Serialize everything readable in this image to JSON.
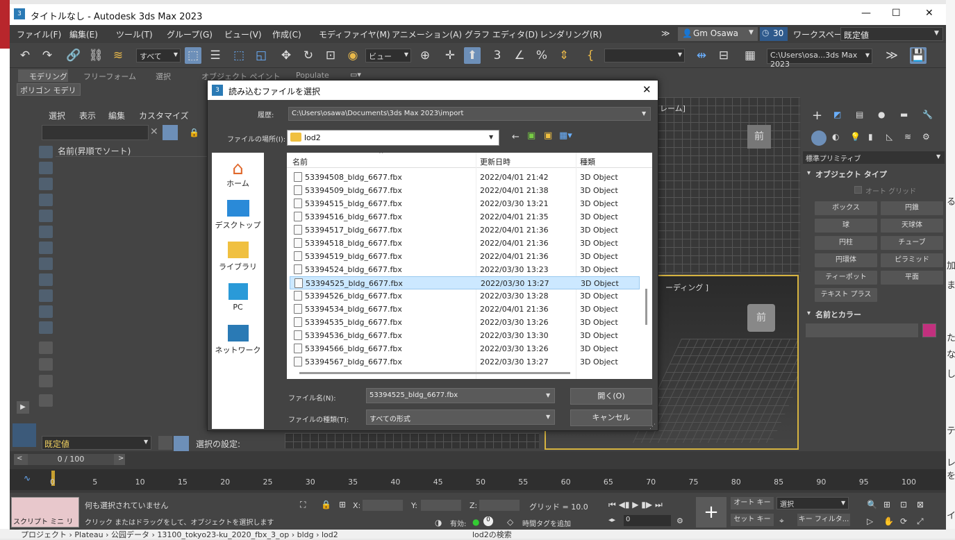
{
  "window": {
    "title": "タイトルなし - Autodesk 3ds Max 2023",
    "minimize": "—",
    "maximize": "☐",
    "close": "✕"
  },
  "menu": {
    "items": [
      "ファイル(F)",
      "編集(E)",
      "ツール(T)",
      "グループ(G)",
      "ビュー(V)",
      "作成(C)",
      "モディファイヤ(M)",
      "アニメーション(A)",
      "グラフ エディタ(D)",
      "レンダリング(R)"
    ],
    "more": "≫",
    "user": "Gm Osawa",
    "clock": "30",
    "workspace_label": "ワークスペース:",
    "workspace_value": "既定値"
  },
  "toolbar": {
    "filter": "すべて",
    "view": "ビュー",
    "path": "C:\\Users\\osa...3ds Max 2023",
    "angle_label": "3",
    "spinner_label": "%"
  },
  "ribbon": {
    "tabs": [
      "モデリング",
      "フリーフォーム",
      "選択",
      "オブジェクト ペイント",
      "Populate"
    ],
    "sub": "ポリゴン モデリング"
  },
  "scene_explorer": {
    "menu": [
      "選択",
      "表示",
      "編集",
      "カスタマイズ"
    ],
    "column": "名前(昇順でソート)",
    "layer": "既定値",
    "selection_set": "選択の設定:"
  },
  "viewports": {
    "top_label": "レーム]",
    "persp_label": "ーディング ]",
    "cube_label": "前"
  },
  "command_panel": {
    "dropdown": "標準プリミティブ",
    "rollout1": "オブジェクト タイプ",
    "autogrid": "オート グリッド",
    "buttons": [
      "ボックス",
      "円錐",
      "球",
      "天球体",
      "円柱",
      "チューブ",
      "円環体",
      "ピラミッド",
      "ティーポット",
      "平面",
      "テキスト プラス"
    ],
    "rollout2": "名前とカラー",
    "color": "#c2307e"
  },
  "timeline": {
    "counter": "0 / 100",
    "ticks": [
      "0",
      "5",
      "10",
      "15",
      "20",
      "25",
      "30",
      "35",
      "40",
      "45",
      "50",
      "55",
      "60",
      "65",
      "70",
      "75",
      "80",
      "85",
      "90",
      "95",
      "100"
    ]
  },
  "status": {
    "script": "スクリプト ミニ リス",
    "line1": "何も選択されていません",
    "line2": "クリック またはドラッグをして、オブジェクトを選択します",
    "x_label": "X:",
    "y_label": "Y:",
    "z_label": "Z:",
    "grid": "グリッド = 10.0",
    "enabled": "有効:",
    "time_tag": "時間タグを追加",
    "frame_value": "0",
    "auto_key": "オート キー",
    "set_key": "セット キー",
    "selection": "選択",
    "key_filter": "キー フィルタ..."
  },
  "dialog": {
    "title": "読み込むファイルを選択",
    "history_label": "履歴:",
    "history_value": "C:\\Users\\osawa\\Documents\\3ds Max 2023\\import",
    "location_label": "ファイルの場所(I):",
    "location_value": "lod2",
    "places": [
      "ホーム",
      "デスクトップ",
      "ライブラリ",
      "PC",
      "ネットワーク"
    ],
    "columns": [
      "名前",
      "更新日時",
      "種類"
    ],
    "files": [
      {
        "name": "53394508_bldg_6677.fbx",
        "date": "2022/04/01 21:42",
        "type": "3D Object"
      },
      {
        "name": "53394509_bldg_6677.fbx",
        "date": "2022/04/01 21:38",
        "type": "3D Object"
      },
      {
        "name": "53394515_bldg_6677.fbx",
        "date": "2022/03/30 13:21",
        "type": "3D Object"
      },
      {
        "name": "53394516_bldg_6677.fbx",
        "date": "2022/04/01 21:35",
        "type": "3D Object"
      },
      {
        "name": "53394517_bldg_6677.fbx",
        "date": "2022/04/01 21:36",
        "type": "3D Object"
      },
      {
        "name": "53394518_bldg_6677.fbx",
        "date": "2022/04/01 21:36",
        "type": "3D Object"
      },
      {
        "name": "53394519_bldg_6677.fbx",
        "date": "2022/04/01 21:36",
        "type": "3D Object"
      },
      {
        "name": "53394524_bldg_6677.fbx",
        "date": "2022/03/30 13:23",
        "type": "3D Object"
      },
      {
        "name": "53394525_bldg_6677.fbx",
        "date": "2022/03/30 13:27",
        "type": "3D Object"
      },
      {
        "name": "53394526_bldg_6677.fbx",
        "date": "2022/03/30 13:28",
        "type": "3D Object"
      },
      {
        "name": "53394534_bldg_6677.fbx",
        "date": "2022/04/01 21:36",
        "type": "3D Object"
      },
      {
        "name": "53394535_bldg_6677.fbx",
        "date": "2022/03/30 13:26",
        "type": "3D Object"
      },
      {
        "name": "53394536_bldg_6677.fbx",
        "date": "2022/03/30 13:30",
        "type": "3D Object"
      },
      {
        "name": "53394566_bldg_6677.fbx",
        "date": "2022/03/30 13:26",
        "type": "3D Object"
      },
      {
        "name": "53394567_bldg_6677.fbx",
        "date": "2022/03/30 13:27",
        "type": "3D Object"
      }
    ],
    "filename_label": "ファイル名(N):",
    "filename_value": "53394525_bldg_6677.fbx",
    "filetype_label": "ファイルの種類(T):",
    "filetype_value": "すべての形式",
    "open": "開く(O)",
    "cancel": "キャンセル"
  },
  "background": {
    "breadcrumb": "プロジェクト  ›  Plateau  ›  公园データ  ›  13100_tokyo23-ku_2020_fbx_3_op  ›  bldg  ›  lod2",
    "search": "lod2の検索",
    "right_chars": [
      "る",
      "加",
      "ま",
      "た",
      "な",
      "し",
      "テ",
      "レを",
      "イ"
    ]
  }
}
